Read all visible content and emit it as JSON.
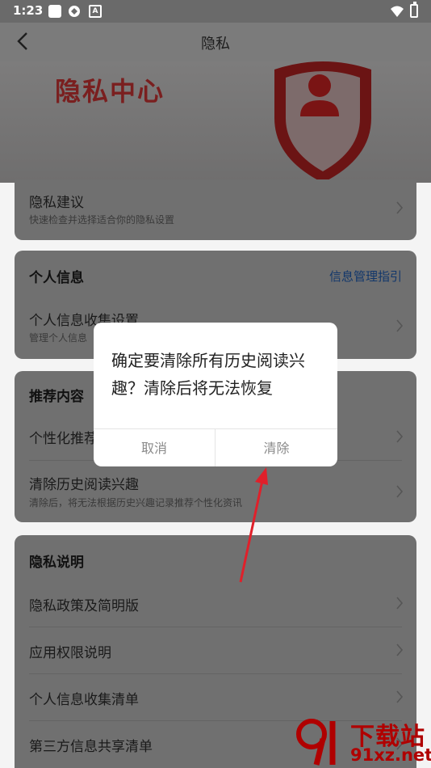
{
  "status_bar": {
    "time": "1:23"
  },
  "header": {
    "title": "隐私"
  },
  "banner": {
    "text": "隐私中心"
  },
  "privacy_suggestion": {
    "title": "隐私建议",
    "subtitle": "快速检查并选择适合你的隐私设置"
  },
  "personal_info": {
    "section_title": "个人信息",
    "link": "信息管理指引",
    "items": [
      {
        "title": "个人信息收集设置",
        "subtitle": "管理个人信息"
      }
    ]
  },
  "recommend": {
    "section_title": "推荐内容",
    "items": [
      {
        "title": "个性化推荐"
      },
      {
        "title": "清除历史阅读兴趣",
        "subtitle": "清除后，将无法根据历史兴趣记录推荐个性化资讯"
      }
    ]
  },
  "privacy_notes": {
    "section_title": "隐私说明",
    "items": [
      {
        "title": "隐私政策及简明版"
      },
      {
        "title": "应用权限说明"
      },
      {
        "title": "个人信息收集清单"
      },
      {
        "title": "第三方信息共享清单"
      }
    ]
  },
  "dialog": {
    "message": "确定要清除所有历史阅读兴趣？清除后将无法恢复",
    "cancel_label": "取消",
    "confirm_label": "清除"
  },
  "watermark": {
    "title": "下载站",
    "url": "91xz.net"
  },
  "colors": {
    "dialog_bg": "#ffffff",
    "link": "#12376b",
    "arrow": "#e0202a",
    "banner_text": "#7a1f1f",
    "watermark": "#b00000"
  },
  "icons": {
    "back": "chevron-left-icon",
    "row": "chevron-right-icon",
    "banner": "shield-person-icon"
  }
}
